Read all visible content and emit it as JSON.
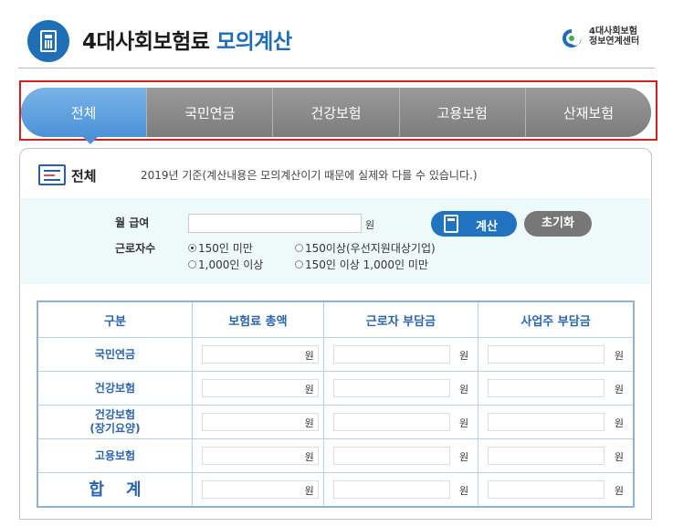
{
  "header": {
    "title_main": "4대사회보험료 ",
    "title_accent": "모의계산",
    "org_line1": "4대사회보험",
    "org_line2": "정보연계센터"
  },
  "tabs": [
    "전체",
    "국민연금",
    "건강보험",
    "고용보험",
    "산재보험"
  ],
  "section": {
    "title": "전체",
    "notice": "2019년 기준(계산내용은 모의계산이기 때문에 실제와 다를 수 있습니다.)"
  },
  "form": {
    "salary_label": "월 급여",
    "salary_value": "",
    "won": "원",
    "workers_label": "근로자수",
    "options": [
      {
        "label": "150인 미만",
        "selected": true
      },
      {
        "label": "150이상(우선지원대상기업)",
        "selected": false
      },
      {
        "label": "1,000인 이상",
        "selected": false
      },
      {
        "label": "150인 이상 1,000인 미만",
        "selected": false
      }
    ],
    "calc_button": "계산",
    "reset_button": "초기화"
  },
  "table": {
    "headers": [
      "구분",
      "보험료 총액",
      "근로자 부담금",
      "사업주 부담금"
    ],
    "rows": [
      {
        "label": "국민연금"
      },
      {
        "label": "건강보험"
      },
      {
        "label": "건강보험\n(장기요양)"
      },
      {
        "label": "고용보험"
      },
      {
        "label": "합계"
      }
    ],
    "won": "원"
  },
  "colors": {
    "accent": "#1f6db8",
    "active_tab": "#4c92d8",
    "inactive_tab": "#8a8a8a",
    "highlight_border": "#d31f1f"
  }
}
